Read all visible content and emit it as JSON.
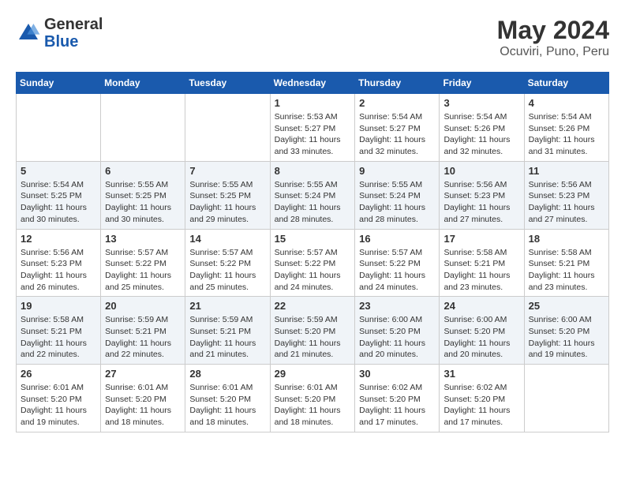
{
  "header": {
    "logo_general": "General",
    "logo_blue": "Blue",
    "month_title": "May 2024",
    "location": "Ocuviri, Puno, Peru"
  },
  "calendar": {
    "days_of_week": [
      "Sunday",
      "Monday",
      "Tuesday",
      "Wednesday",
      "Thursday",
      "Friday",
      "Saturday"
    ],
    "weeks": [
      [
        {
          "day": "",
          "info": ""
        },
        {
          "day": "",
          "info": ""
        },
        {
          "day": "",
          "info": ""
        },
        {
          "day": "1",
          "info": "Sunrise: 5:53 AM\nSunset: 5:27 PM\nDaylight: 11 hours and 33 minutes."
        },
        {
          "day": "2",
          "info": "Sunrise: 5:54 AM\nSunset: 5:27 PM\nDaylight: 11 hours and 32 minutes."
        },
        {
          "day": "3",
          "info": "Sunrise: 5:54 AM\nSunset: 5:26 PM\nDaylight: 11 hours and 32 minutes."
        },
        {
          "day": "4",
          "info": "Sunrise: 5:54 AM\nSunset: 5:26 PM\nDaylight: 11 hours and 31 minutes."
        }
      ],
      [
        {
          "day": "5",
          "info": "Sunrise: 5:54 AM\nSunset: 5:25 PM\nDaylight: 11 hours and 30 minutes."
        },
        {
          "day": "6",
          "info": "Sunrise: 5:55 AM\nSunset: 5:25 PM\nDaylight: 11 hours and 30 minutes."
        },
        {
          "day": "7",
          "info": "Sunrise: 5:55 AM\nSunset: 5:25 PM\nDaylight: 11 hours and 29 minutes."
        },
        {
          "day": "8",
          "info": "Sunrise: 5:55 AM\nSunset: 5:24 PM\nDaylight: 11 hours and 28 minutes."
        },
        {
          "day": "9",
          "info": "Sunrise: 5:55 AM\nSunset: 5:24 PM\nDaylight: 11 hours and 28 minutes."
        },
        {
          "day": "10",
          "info": "Sunrise: 5:56 AM\nSunset: 5:23 PM\nDaylight: 11 hours and 27 minutes."
        },
        {
          "day": "11",
          "info": "Sunrise: 5:56 AM\nSunset: 5:23 PM\nDaylight: 11 hours and 27 minutes."
        }
      ],
      [
        {
          "day": "12",
          "info": "Sunrise: 5:56 AM\nSunset: 5:23 PM\nDaylight: 11 hours and 26 minutes."
        },
        {
          "day": "13",
          "info": "Sunrise: 5:57 AM\nSunset: 5:22 PM\nDaylight: 11 hours and 25 minutes."
        },
        {
          "day": "14",
          "info": "Sunrise: 5:57 AM\nSunset: 5:22 PM\nDaylight: 11 hours and 25 minutes."
        },
        {
          "day": "15",
          "info": "Sunrise: 5:57 AM\nSunset: 5:22 PM\nDaylight: 11 hours and 24 minutes."
        },
        {
          "day": "16",
          "info": "Sunrise: 5:57 AM\nSunset: 5:22 PM\nDaylight: 11 hours and 24 minutes."
        },
        {
          "day": "17",
          "info": "Sunrise: 5:58 AM\nSunset: 5:21 PM\nDaylight: 11 hours and 23 minutes."
        },
        {
          "day": "18",
          "info": "Sunrise: 5:58 AM\nSunset: 5:21 PM\nDaylight: 11 hours and 23 minutes."
        }
      ],
      [
        {
          "day": "19",
          "info": "Sunrise: 5:58 AM\nSunset: 5:21 PM\nDaylight: 11 hours and 22 minutes."
        },
        {
          "day": "20",
          "info": "Sunrise: 5:59 AM\nSunset: 5:21 PM\nDaylight: 11 hours and 22 minutes."
        },
        {
          "day": "21",
          "info": "Sunrise: 5:59 AM\nSunset: 5:21 PM\nDaylight: 11 hours and 21 minutes."
        },
        {
          "day": "22",
          "info": "Sunrise: 5:59 AM\nSunset: 5:20 PM\nDaylight: 11 hours and 21 minutes."
        },
        {
          "day": "23",
          "info": "Sunrise: 6:00 AM\nSunset: 5:20 PM\nDaylight: 11 hours and 20 minutes."
        },
        {
          "day": "24",
          "info": "Sunrise: 6:00 AM\nSunset: 5:20 PM\nDaylight: 11 hours and 20 minutes."
        },
        {
          "day": "25",
          "info": "Sunrise: 6:00 AM\nSunset: 5:20 PM\nDaylight: 11 hours and 19 minutes."
        }
      ],
      [
        {
          "day": "26",
          "info": "Sunrise: 6:01 AM\nSunset: 5:20 PM\nDaylight: 11 hours and 19 minutes."
        },
        {
          "day": "27",
          "info": "Sunrise: 6:01 AM\nSunset: 5:20 PM\nDaylight: 11 hours and 18 minutes."
        },
        {
          "day": "28",
          "info": "Sunrise: 6:01 AM\nSunset: 5:20 PM\nDaylight: 11 hours and 18 minutes."
        },
        {
          "day": "29",
          "info": "Sunrise: 6:01 AM\nSunset: 5:20 PM\nDaylight: 11 hours and 18 minutes."
        },
        {
          "day": "30",
          "info": "Sunrise: 6:02 AM\nSunset: 5:20 PM\nDaylight: 11 hours and 17 minutes."
        },
        {
          "day": "31",
          "info": "Sunrise: 6:02 AM\nSunset: 5:20 PM\nDaylight: 11 hours and 17 minutes."
        },
        {
          "day": "",
          "info": ""
        }
      ]
    ]
  }
}
